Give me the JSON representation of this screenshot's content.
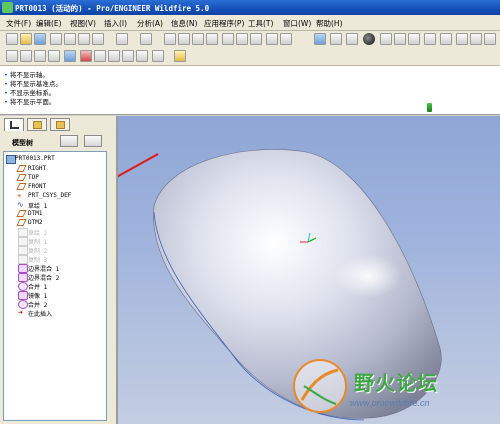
{
  "window": {
    "title": "PRT0013 (活动的) - Pro/ENGINEER Wildfire 5.0"
  },
  "menu": [
    "文件(F)",
    "编辑(E)",
    "视图(V)",
    "插入(I)",
    "分析(A)",
    "信息(N)",
    "应用程序(P)",
    "工具(T)",
    "窗口(W)",
    "帮助(H)"
  ],
  "messages": [
    "将不显示轴。",
    "将不显示基准点。",
    "不显示坐标系。",
    "将不显示平面。"
  ],
  "panel": {
    "title": "模型树"
  },
  "tree": {
    "root": "PRT0013.PRT",
    "items": [
      {
        "label": "RIGHT",
        "icon": "datum-plane-icon",
        "dim": false
      },
      {
        "label": "TOP",
        "icon": "datum-plane-icon",
        "dim": false
      },
      {
        "label": "FRONT",
        "icon": "datum-plane-icon",
        "dim": false
      },
      {
        "label": "PRT_CSYS_DEF",
        "icon": "csys-icon",
        "dim": false
      },
      {
        "label": "草绘 1",
        "icon": "sketch-icon",
        "dim": false
      },
      {
        "label": "DTM1",
        "icon": "datum-plane-icon",
        "dim": false
      },
      {
        "label": "DTM2",
        "icon": "datum-plane-icon",
        "dim": false
      },
      {
        "label": "草绘 2",
        "icon": "sketch-icon",
        "dim": true
      },
      {
        "label": "复制 1",
        "icon": "copy-icon",
        "dim": true
      },
      {
        "label": "复制 2",
        "icon": "copy-icon",
        "dim": true
      },
      {
        "label": "复制 3",
        "icon": "copy-icon",
        "dim": true
      },
      {
        "label": "边界混合 1",
        "icon": "boundary-blend-icon",
        "dim": false
      },
      {
        "label": "边界混合 2",
        "icon": "boundary-blend-icon",
        "dim": false
      },
      {
        "label": "合并 1",
        "icon": "merge-icon",
        "dim": false
      },
      {
        "label": "镜像 1",
        "icon": "mirror-icon",
        "dim": false
      },
      {
        "label": "合并 2",
        "icon": "merge-icon",
        "dim": false
      },
      {
        "label": "在此插入",
        "icon": "insert-here-icon",
        "dim": false
      }
    ]
  },
  "watermark": {
    "text": "野火论坛",
    "url": "www.proewildfire.cn"
  }
}
